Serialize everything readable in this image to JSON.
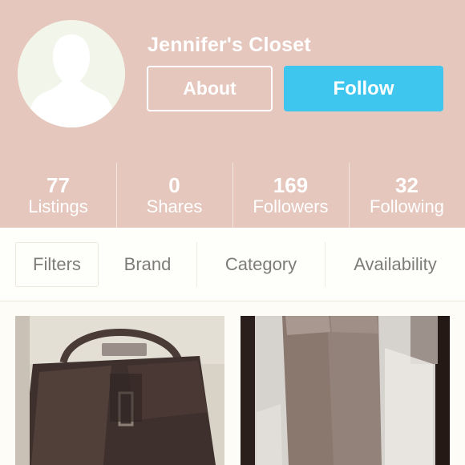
{
  "profile": {
    "closet_name": "Jennifer's Closet",
    "about_label": "About",
    "follow_label": "Follow",
    "colors": {
      "header_bg": "#e5c7bd",
      "follow_bg": "#3ec6ef"
    }
  },
  "stats": [
    {
      "value": "77",
      "label": "Listings"
    },
    {
      "value": "0",
      "label": "Shares"
    },
    {
      "value": "169",
      "label": "Followers"
    },
    {
      "value": "32",
      "label": "Following"
    }
  ],
  "filters": [
    "Filters",
    "Brand",
    "Category",
    "Availability"
  ],
  "listings": [
    {
      "image": "brown-leather-handbag"
    },
    {
      "image": "tall-suede-boots"
    }
  ]
}
